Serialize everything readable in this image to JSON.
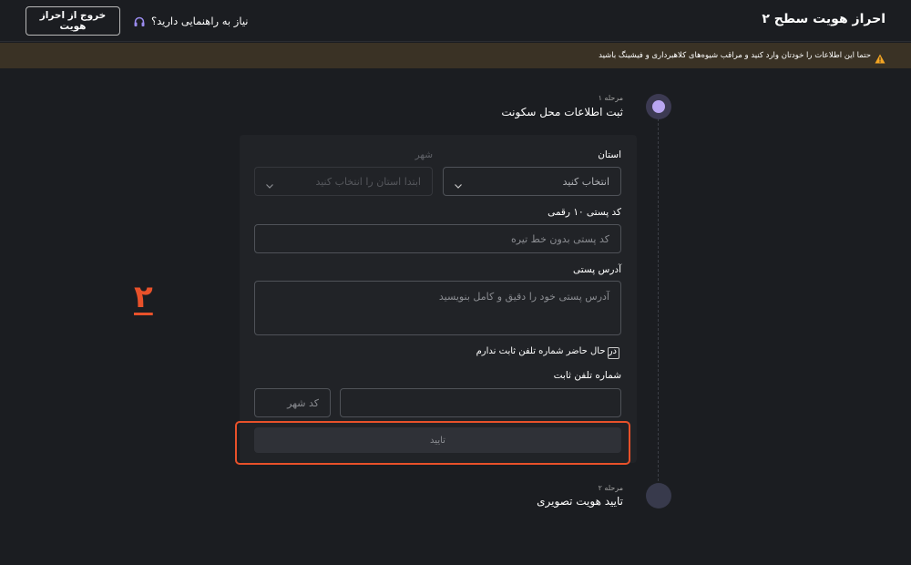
{
  "header": {
    "title": "احراز هویت سطح ۲",
    "exit_label": "خروج از احراز هویت",
    "help_label": "نیاز به راهنمایی دارید؟"
  },
  "warning": {
    "text": "حتما این اطلاعات را خودتان وارد کنید و مراقب شیوه‌های کلاهبرداری و فیشینگ باشید",
    "icon": "warning-triangle-icon",
    "color": "#f5a623"
  },
  "steps": [
    {
      "label": "مرحله ۱",
      "title": "ثبت اطلاعات محل سکونت",
      "state": "active"
    },
    {
      "label": "مرحله ۲",
      "title": "تایید هویت تصویری",
      "state": "pending"
    }
  ],
  "form": {
    "province_label": "استان",
    "province_value": "انتخاب کنید",
    "city_label": "شهر",
    "city_value": "ابتدا استان را انتخاب کنید",
    "postal_label": "کد پستی ۱۰ رقمی",
    "postal_placeholder": "کد پستی بدون خط تیره",
    "address_label": "آدرس پستی",
    "address_placeholder": "آدرس پستی خود را دقیق و کامل بنویسید",
    "no_landline_label": "در حال حاضر شماره تلفن ثابت ندارم",
    "no_landline_checked": false,
    "phone_label": "شماره تلفن ثابت",
    "phone_value": "",
    "area_code_placeholder": "کد شهر",
    "confirm_label": "تایید"
  },
  "annotation": {
    "number": "۲",
    "color": "#e8512a"
  }
}
